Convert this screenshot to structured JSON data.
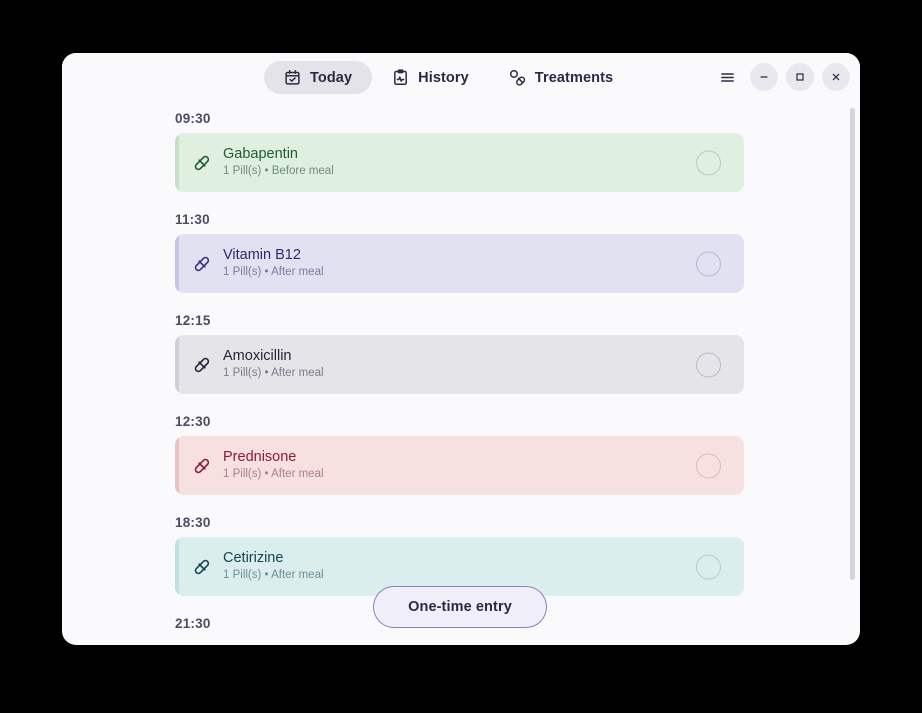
{
  "window": {
    "background_color": "#fafafc",
    "desktop_color": "#000000"
  },
  "header": {
    "tabs": [
      {
        "label": "Today",
        "icon": "calendar-check-icon",
        "active": true
      },
      {
        "label": "History",
        "icon": "clipboard-chart-icon",
        "active": false
      },
      {
        "label": "Treatments",
        "icon": "pills-icon",
        "active": false
      }
    ],
    "menu_icon": "hamburger-menu-icon",
    "controls": [
      {
        "name": "minimize",
        "icon": "minimize-icon",
        "glyph": "–"
      },
      {
        "name": "maximize",
        "icon": "maximize-icon",
        "glyph": "□"
      },
      {
        "name": "close",
        "icon": "close-icon",
        "glyph": "×"
      }
    ]
  },
  "schedule": {
    "entries": [
      {
        "time": "09:30",
        "name": "Gabapentin",
        "details": "1 Pill(s)  •  Before meal",
        "dose": "1 Pill(s)",
        "meal": "Before meal",
        "card_bg": "#dff0e0",
        "accent": "#c4e0c6",
        "name_color": "#1f5c34",
        "sub_color": "#6f8d78",
        "icon_color": "#1f5c34",
        "circle_color": "#b5cdb8",
        "taken": false
      },
      {
        "time": "11:30",
        "name": "Vitamin B12",
        "details": "1 Pill(s)  •  After meal",
        "dose": "1 Pill(s)",
        "meal": "After meal",
        "card_bg": "#e2e1f2",
        "accent": "#c6c3e4",
        "name_color": "#2e2a6b",
        "sub_color": "#7d7a9c",
        "icon_color": "#3b3184",
        "circle_color": "#b9b6d4",
        "taken": false
      },
      {
        "time": "12:15",
        "name": "Amoxicillin",
        "details": "1 Pill(s)  •  After meal",
        "dose": "1 Pill(s)",
        "meal": "After meal",
        "card_bg": "#e4e4e9",
        "accent": "#cfcfd7",
        "name_color": "#24243a",
        "sub_color": "#7c7c8c",
        "icon_color": "#24243a",
        "circle_color": "#bcbcc6",
        "taken": false
      },
      {
        "time": "12:30",
        "name": "Prednisone",
        "details": "1 Pill(s)  •  After meal",
        "dose": "1 Pill(s)",
        "meal": "After meal",
        "card_bg": "#f7e0e0",
        "accent": "#e9c3c4",
        "name_color": "#8c1b3a",
        "sub_color": "#a8808c",
        "icon_color": "#8c1b3a",
        "circle_color": "#e0b9bd",
        "taken": false
      },
      {
        "time": "18:30",
        "name": "Cetirizine",
        "details": "1 Pill(s)  •  After meal",
        "dose": "1 Pill(s)",
        "meal": "After meal",
        "card_bg": "#daeeee",
        "accent": "#bfe0e0",
        "name_color": "#14454f",
        "sub_color": "#6e8e94",
        "icon_color": "#14454f",
        "circle_color": "#b0cdcf",
        "taken": false
      },
      {
        "time": "21:30",
        "name": "",
        "details": "",
        "partial": true
      }
    ]
  },
  "floating_action": {
    "label": "One-time entry",
    "bg": "#f0eef8",
    "border": "#8d7ec0",
    "text_color": "#2b2a45"
  },
  "scrollbar": {
    "thumb_color": "#d5d4dd",
    "orientation": "vertical"
  }
}
